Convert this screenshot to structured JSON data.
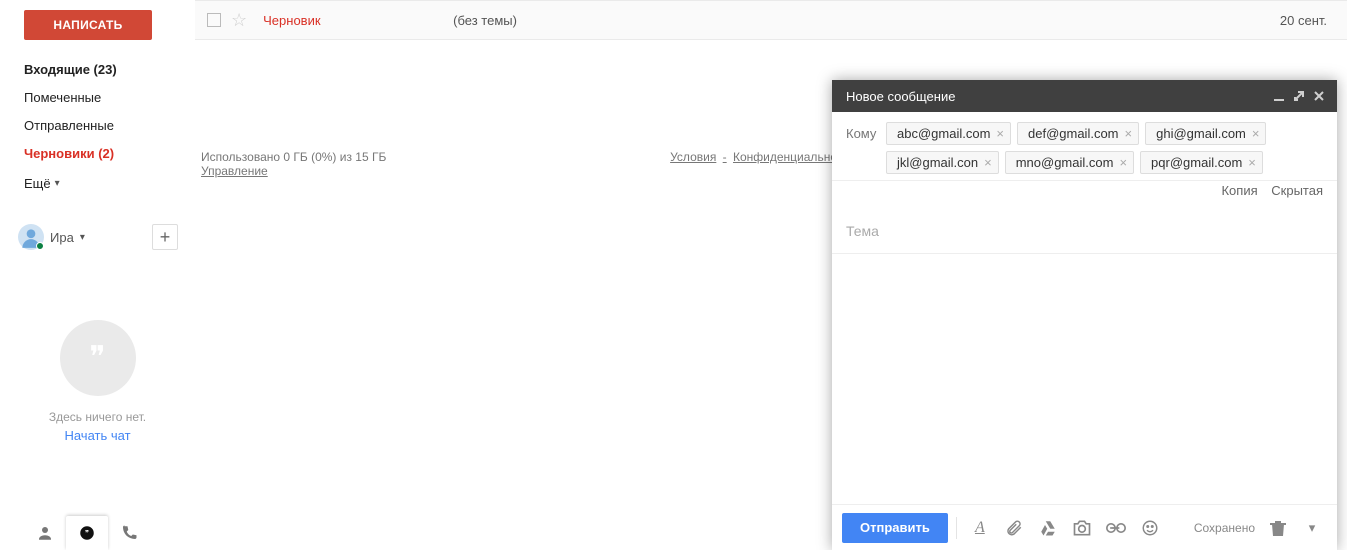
{
  "sidebar": {
    "compose_label": "НАПИСАТЬ",
    "items": [
      {
        "label": "Входящие (23)",
        "kind": "bold"
      },
      {
        "label": "Помеченные",
        "kind": ""
      },
      {
        "label": "Отправленные",
        "kind": ""
      },
      {
        "label": "Черновики (2)",
        "kind": "red"
      }
    ],
    "more_label": "Ещё"
  },
  "user": {
    "name": "Ира"
  },
  "hangouts": {
    "empty_text": "Здесь ничего нет.",
    "start_chat": "Начать чат"
  },
  "message": {
    "from": "Черновик",
    "subject": "(без темы)",
    "date": "20 сент."
  },
  "storage": {
    "line": "Использовано 0 ГБ (0%) из 15 ГБ",
    "manage": "Управление"
  },
  "footer": {
    "terms": "Условия",
    "privacy": "Конфиденциально",
    "sep": "-"
  },
  "compose": {
    "title": "Новое сообщение",
    "to_label": "Кому",
    "recipients": [
      "abc@gmail.com",
      "def@gmail.com",
      "ghi@gmail.com",
      "jkl@gmail.con",
      "mno@gmail.com",
      "pqr@gmail.com"
    ],
    "cc": "Копия",
    "bcc": "Скрытая",
    "subject_placeholder": "Тема",
    "send": "Отправить",
    "saved": "Сохранено"
  }
}
